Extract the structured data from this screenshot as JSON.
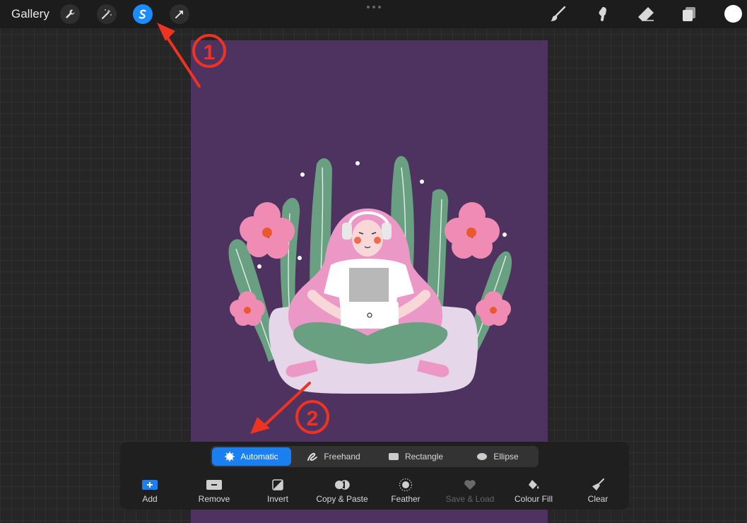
{
  "topbar": {
    "gallery_label": "Gallery",
    "tools_left": [
      "wrench-icon",
      "magic-wand-icon",
      "selection-icon",
      "transform-arrow-icon"
    ],
    "tools_right": [
      "brush-icon",
      "smudge-icon",
      "eraser-icon",
      "layers-icon"
    ],
    "active_tool": "selection",
    "accent_color": "#1a8cff",
    "current_color": "#ffffff"
  },
  "annotations": {
    "marker_1": "1",
    "marker_2": "2",
    "color": "#ee3322"
  },
  "selection_modes": [
    {
      "label": "Automatic",
      "icon": "starburst-icon",
      "active": true
    },
    {
      "label": "Freehand",
      "icon": "freehand-icon",
      "active": false
    },
    {
      "label": "Rectangle",
      "icon": "rectangle-icon",
      "active": false
    },
    {
      "label": "Ellipse",
      "icon": "ellipse-icon",
      "active": false
    }
  ],
  "actions": [
    {
      "label": "Add",
      "icon": "plus-icon",
      "enabled": true
    },
    {
      "label": "Remove",
      "icon": "minus-icon",
      "enabled": true
    },
    {
      "label": "Invert",
      "icon": "invert-icon",
      "enabled": true
    },
    {
      "label": "Copy & Paste",
      "icon": "copy-paste-icon",
      "enabled": true
    },
    {
      "label": "Feather",
      "icon": "feather-icon",
      "enabled": true
    },
    {
      "label": "Save & Load",
      "icon": "heart-icon",
      "enabled": false
    },
    {
      "label": "Colour Fill",
      "icon": "fill-bucket-icon",
      "enabled": true
    },
    {
      "label": "Clear",
      "icon": "clear-broom-icon",
      "enabled": true
    }
  ]
}
